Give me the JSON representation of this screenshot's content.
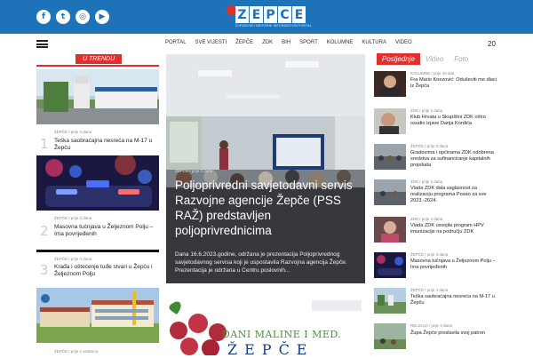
{
  "social": [
    {
      "icon": "facebook-icon",
      "glyph": "f"
    },
    {
      "icon": "twitter-icon",
      "glyph": "t"
    },
    {
      "icon": "instagram-icon",
      "glyph": "◎"
    },
    {
      "icon": "youtube-icon",
      "glyph": "▶"
    }
  ],
  "logo": {
    "letters": [
      "Z",
      "E",
      "P",
      "C",
      "E"
    ],
    "tagline": "ŽUPANIJSKI NEOVISNI INFORMATIVNI PORTAL"
  },
  "menu": [
    "PORTAL",
    "SVE VIJESTI",
    "ŽEPČE",
    "ZDK",
    "BIH",
    "SPORT",
    "KOLUMNE",
    "KULTURA",
    "VIDEO"
  ],
  "tabs": {
    "active": "Posljednje",
    "video": "Video",
    "foto": "Foto",
    "count": "20"
  },
  "trending": {
    "heading": "U TRENDU",
    "items": [
      {
        "meta": "ŽEPČE  /  prije 4 dana",
        "num": "1",
        "title": "Teška saobraćajna nesreća na M-17 u Žepču"
      },
      {
        "meta": "ŽEPČE  /  prije 3 dana",
        "num": "2",
        "title": "Masovna tučnjava u Željeznom Polju – Ima povrijeđenih"
      },
      {
        "meta": "ŽEPČE  /  prije 4 dana",
        "num": "3",
        "title": "Krađa i oštećenje tuđe stvari u Žepču i Željeznom Polju"
      },
      {
        "meta": "ŽEPČE  /  prije 1 sedmica"
      }
    ]
  },
  "hero": {
    "meta": "ŽEPČE  /  prije 3 dana",
    "title": "Poljoprivredni savjetodavni servis Razvojne agencije Žepče (PSS RAŽ) predstavljen poljoprivrednicima",
    "excerpt": "Dana 16.6.2023.godine, održana je prezentacija Poljoprivrednog savjetodavnog servisa koji je uspostavila Razvojna agencija Žepče. Prezentacija je održana u Centru poslovnih..."
  },
  "banner": {
    "line1": "DANI MALINE I MED.",
    "line2": "ŽEPČE"
  },
  "sidebar": [
    {
      "meta": "KOLUMNE  /  prije 18 sati",
      "title": "Fra Mario Knezović: Oduševiti me dlaci iz Žepča"
    },
    {
      "meta": "ZDK  /  prije 3 dana",
      "title": "Klub Hrvata u Skupštini ZDK oštro osudio izjave Darija Kordića"
    },
    {
      "meta": "ŽEPČE  /  prije 3 dana",
      "title": "Gradovima i općinama ZDK odobrena sredstva za sufinanciranje kapitalnih projekata"
    },
    {
      "meta": "ZDK  /  prije 3 dana",
      "title": "Vlada ZDK dala saglasnost za realizaciju programa Posao za sve 2023.-2024."
    },
    {
      "meta": "ZDK  /  prije 3 dana",
      "title": "Vlada ZDK usvojila program HPV imunizacije na području ZDK"
    },
    {
      "meta": "ŽEPČE  /  prije 3 dana",
      "title": "Masovna tučnjava u Željeznom Polju – Ima povrijeđenih"
    },
    {
      "meta": "ŽEPČE  /  prije 4 dana",
      "title": "Teška saobraćajna nesreća na M-17 u Žepču"
    },
    {
      "meta": "RELIGIJA  /  prije 4 dana",
      "title": "Župa Žepče proslavila svoj patron"
    }
  ],
  "colors": {
    "brand_blue": "#1e72b8",
    "accent_red": "#e0302e"
  }
}
